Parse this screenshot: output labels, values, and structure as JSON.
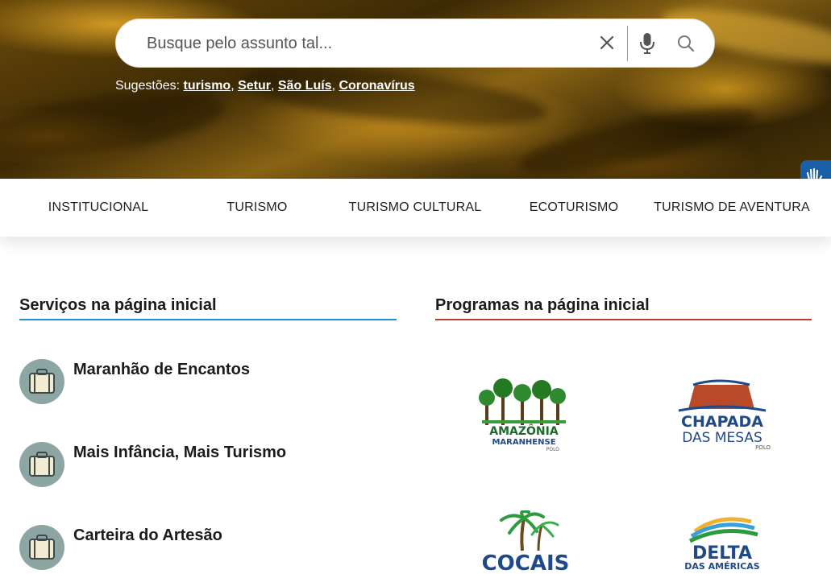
{
  "search": {
    "placeholder": "Busque pelo assunto tal...",
    "suggestions_label": "Sugestões:",
    "suggestions": [
      "turismo",
      "Setur",
      "São Luís",
      "Coronavírus"
    ]
  },
  "nav": {
    "items": [
      "INSTITUCIONAL",
      "TURISMO",
      "TURISMO CULTURAL",
      "ECOTURISMO",
      "TURISMO DE AVENTURA"
    ]
  },
  "services": {
    "title": "Serviços na página inicial",
    "accent": "#1f8fd0",
    "items": [
      "Maranhão de Encantos",
      "Mais Infância, Mais Turismo",
      "Carteira do Artesão"
    ]
  },
  "programs": {
    "title": "Programas na página inicial",
    "accent": "#c0392b",
    "logos": [
      {
        "line1": "AMAZÔNIA",
        "line2": "MARANHENSE",
        "line3": "POLO"
      },
      {
        "line1": "CHAPADA",
        "line2": "DAS MESAS",
        "line3": "POLO"
      },
      {
        "line1": "COCAIS"
      },
      {
        "line1": "DELTA",
        "line2": "DAS AMÉRICAS"
      }
    ]
  },
  "icons": {
    "clear": "close-icon",
    "mic": "microphone-icon",
    "search": "search-icon",
    "accessibility": "sign-language-hands-icon",
    "service": "suitcase-icon"
  }
}
